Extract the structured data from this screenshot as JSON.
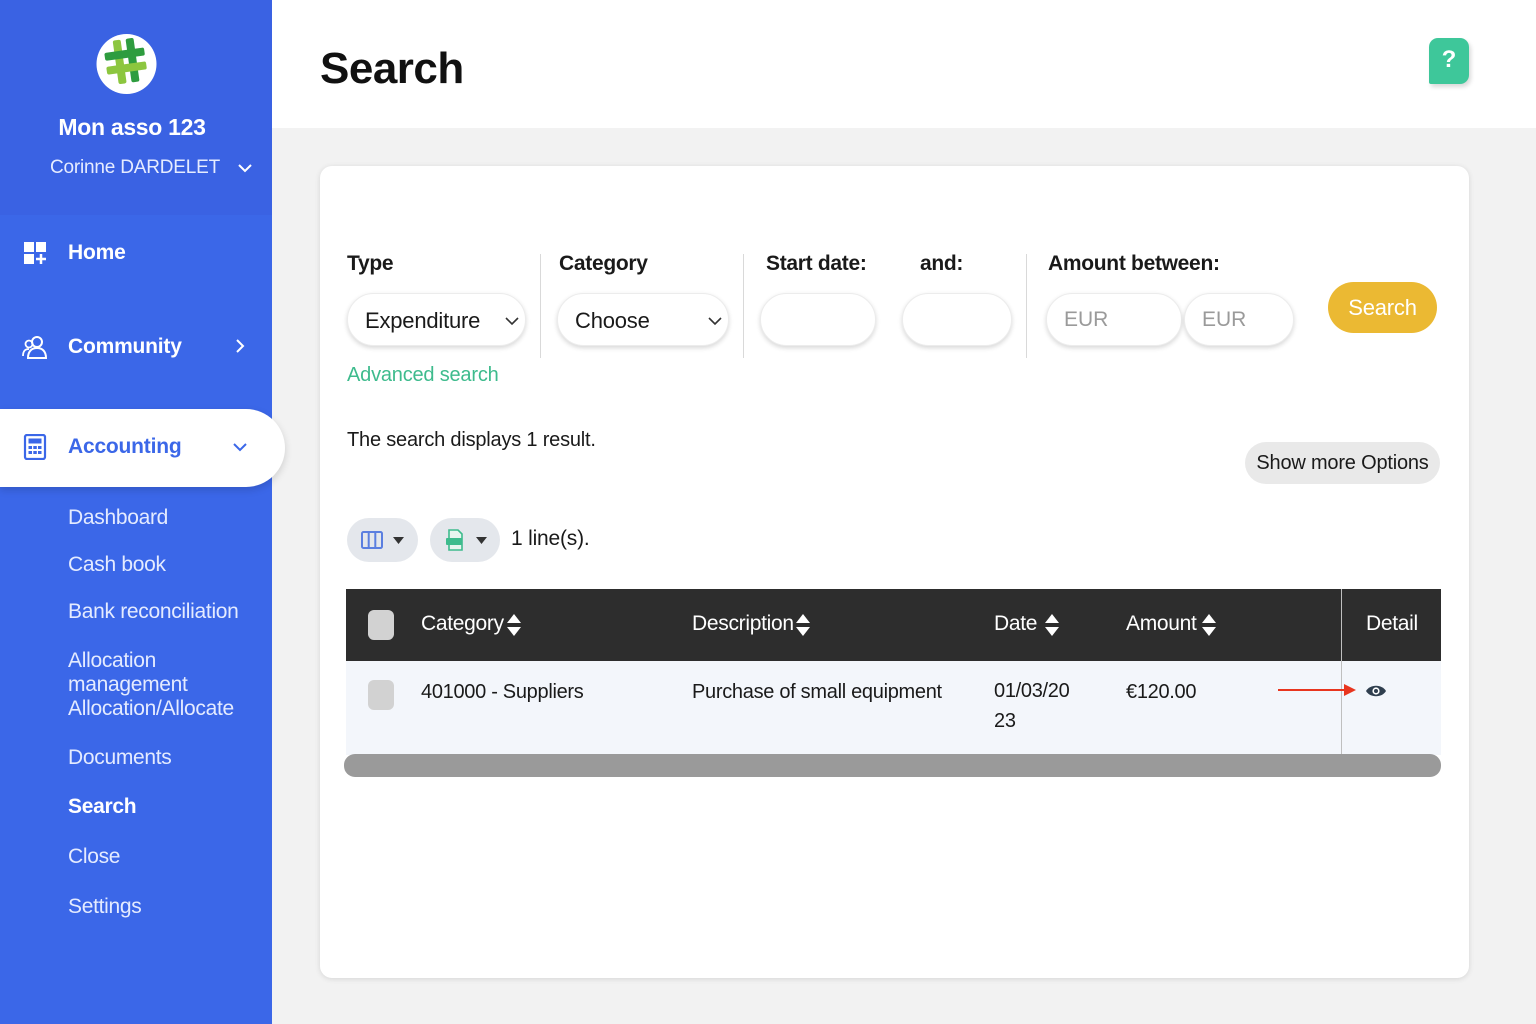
{
  "sidebar": {
    "org_name": "Mon asso 123",
    "user_name": "Corinne DARDELET",
    "nav": {
      "home": "Home",
      "community": "Community",
      "accounting": "Accounting"
    },
    "sub_items": [
      "Dashboard",
      "Cash book",
      "Bank reconciliation",
      "Allocation management",
      "Allocation/Allocate",
      "Documents",
      "Search",
      "Close",
      "Settings"
    ]
  },
  "header": {
    "title": "Search",
    "help_label": "?"
  },
  "filters": {
    "type_label": "Type",
    "type_value": "Expenditure",
    "category_label": "Category",
    "category_value": "Choose",
    "start_date_label": "Start date:",
    "and_label": "and:",
    "amount_label": "Amount between:",
    "amount_min_placeholder": "EUR",
    "amount_max_placeholder": "EUR",
    "search_button": "Search",
    "advanced_link": "Advanced search"
  },
  "results": {
    "summary": "The search displays 1 result.",
    "more_options": "Show more Options",
    "lines_count": "1 line(s)."
  },
  "table": {
    "headers": {
      "category": "Category",
      "description": "Description",
      "date": "Date",
      "amount": "Amount",
      "detail": "Detail"
    },
    "rows": [
      {
        "category": "401000 - Suppliers",
        "description": "Purchase of small equipment",
        "date": "01/03/2023",
        "amount": "€120.00"
      }
    ]
  },
  "colors": {
    "sidebar": "#3b67e8",
    "accent_green": "#3ebb8d",
    "search_button": "#ebb933",
    "table_header": "#2d2d2d",
    "arrow": "#e8351e"
  }
}
